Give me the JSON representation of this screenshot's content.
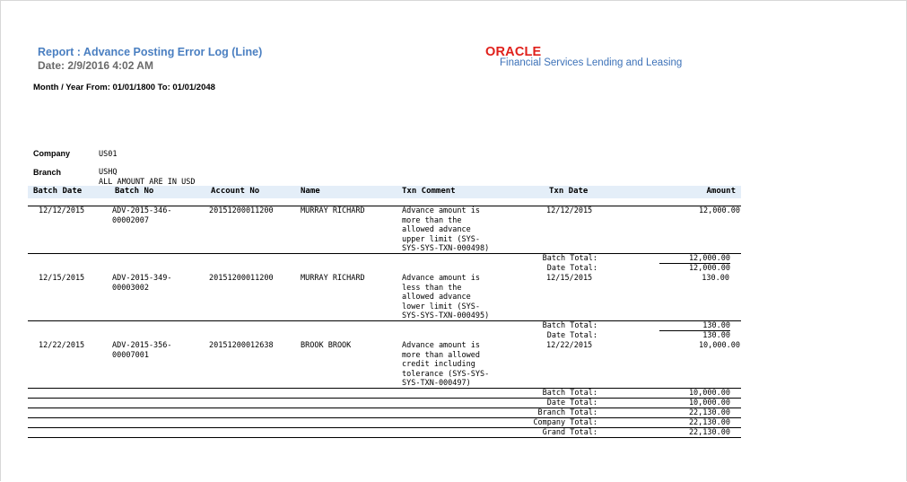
{
  "report": {
    "title": "Report : Advance Posting Error Log (Line)",
    "date": "Date: 2/9/2016  4:02 AM",
    "period": "Month / Year  From: 01/01/1800 To: 01/01/2048"
  },
  "logo": {
    "brand": "ORACLE",
    "tagline": "Financial Services Lending and Leasing",
    "brand_color": "#e0201b",
    "tagline_color": "#3d72b8"
  },
  "meta": {
    "company_label": "Company",
    "company_value": "US01",
    "branch_label": "Branch",
    "branch_value": "USHQ",
    "currency_note": "ALL AMOUNT ARE IN USD"
  },
  "columns": [
    "Batch Date",
    "Batch No",
    "Account No",
    "Name",
    "Txn Comment",
    "Txn Date",
    "Amount"
  ],
  "rows": [
    {
      "batch_date": "12/12/2015",
      "batch_no": "ADV-2015-346-\n00002007",
      "account_no": "20151200011200",
      "name": "MURRAY RICHARD",
      "txn_comment": "Advance amount is\nmore than the\nallowed advance\nupper limit (SYS-\nSYS-SYS-TXN-000498)",
      "txn_date": "12/12/2015",
      "amount": "12,000.00",
      "totals": [
        {
          "label": "Batch Total:",
          "value": "12,000.00"
        },
        {
          "label": "Date Total:",
          "value": "12,000.00"
        }
      ]
    },
    {
      "batch_date": "12/15/2015",
      "batch_no": "ADV-2015-349-\n00003002",
      "account_no": "20151200011200",
      "name": "MURRAY RICHARD",
      "txn_comment": "Advance amount is\nless than the\nallowed advance\nlower limit (SYS-\nSYS-SYS-TXN-000495)",
      "txn_date": "12/15/2015",
      "amount": "130.00",
      "totals": [
        {
          "label": "Batch Total:",
          "value": "130.00"
        },
        {
          "label": "Date Total:",
          "value": "130.00"
        }
      ]
    },
    {
      "batch_date": "12/22/2015",
      "batch_no": "ADV-2015-356-\n00007001",
      "account_no": "20151200012638",
      "name": "BROOK BROOK",
      "txn_comment": "Advance amount is\nmore than allowed\ncredit including\ntolerance (SYS-SYS-\nSYS-TXN-000497)",
      "txn_date": "12/22/2015",
      "amount": "10,000.00",
      "totals": [
        {
          "label": "Batch Total:",
          "value": "10,000.00"
        },
        {
          "label": "Date Total:",
          "value": "10,000.00"
        }
      ]
    }
  ],
  "grand_totals": [
    {
      "label": "Branch Total:",
      "value": "22,130.00"
    },
    {
      "label": "Company Total:",
      "value": "22,130.00"
    },
    {
      "label": "Grand Total:",
      "value": "22,130.00"
    }
  ]
}
